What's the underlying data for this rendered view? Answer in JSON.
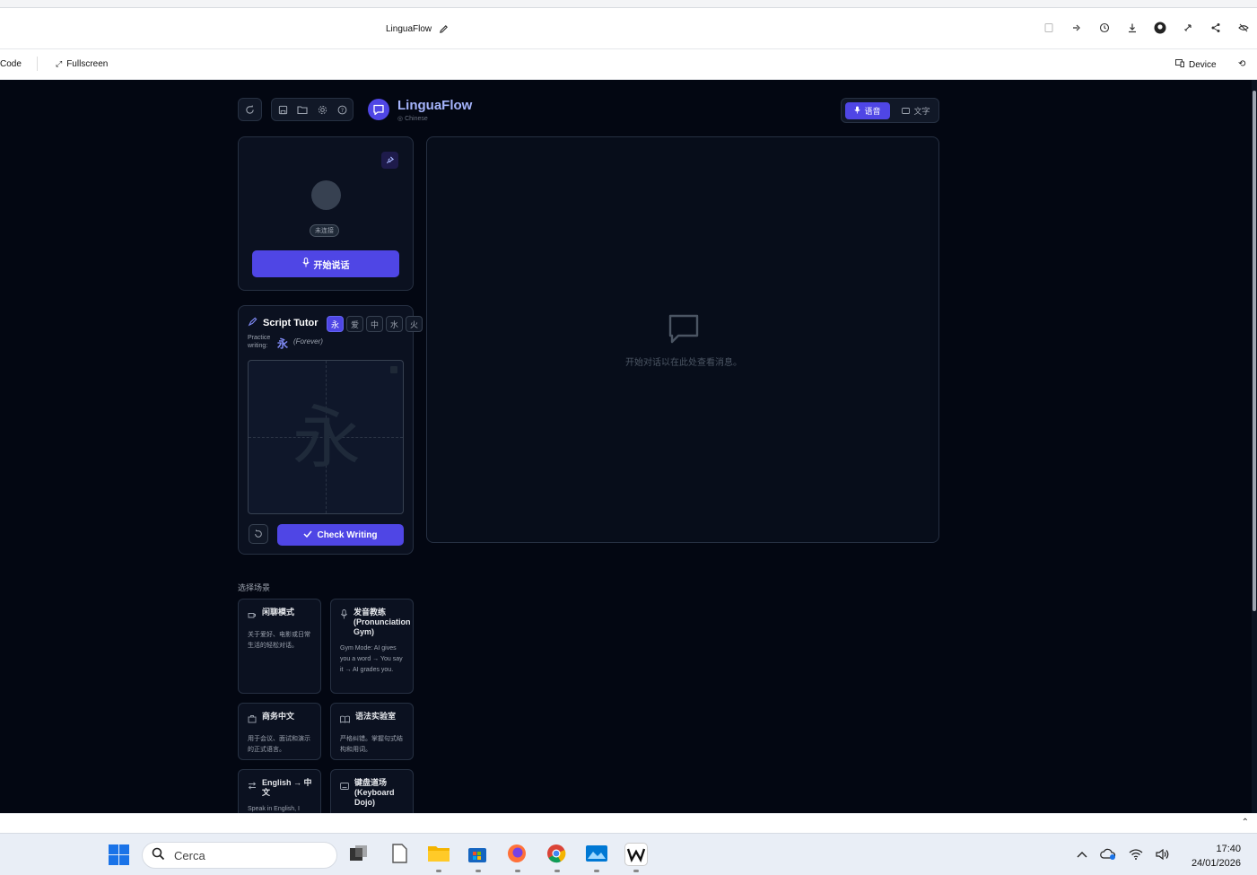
{
  "header": {
    "project_title": "LinguaFlow"
  },
  "subbar": {
    "code_label": "Code",
    "fullscreen_label": "Fullscreen",
    "device_label": "Device"
  },
  "app": {
    "name": "LinguaFlow",
    "language": "Chinese",
    "mode_voice": "语音",
    "mode_text": "文字"
  },
  "voice_panel": {
    "status": "未连接",
    "start_label": "开始说话"
  },
  "script_tutor": {
    "title": "Script Tutor",
    "characters": [
      "永",
      "爱",
      "中",
      "水",
      "火"
    ],
    "practice_label": "Practice writing:",
    "practice_char": "永",
    "practice_meaning": "(Forever)",
    "ghost_char": "永",
    "check_label": "Check Writing"
  },
  "chat": {
    "empty_text": "开始对话以在此处查看消息。"
  },
  "scenarios": {
    "title": "选择场景",
    "items": [
      {
        "title": "闲聊模式",
        "desc": "关于爱好、电影或日常生活的轻松对话。"
      },
      {
        "title": "发音教练 (Pronunciation Gym)",
        "desc": "Gym Mode: AI gives you a word → You say it → AI grades you."
      },
      {
        "title": "商务中文",
        "desc": "用于会议、面试和演示的正式语言。"
      },
      {
        "title": "语法实验室",
        "desc": "严格纠错。掌握句式结构和用词。"
      },
      {
        "title": "English → 中文",
        "desc": "Speak in English, I"
      },
      {
        "title": "键盘道场 (Keyboard Dojo)",
        "desc": ""
      }
    ]
  },
  "taskbar": {
    "search_placeholder": "Cerca",
    "time": "17:40",
    "date": "24/01/2026"
  },
  "colors": {
    "accent": "#4f46e5",
    "background": "#030712",
    "panel": "#0b1120"
  }
}
